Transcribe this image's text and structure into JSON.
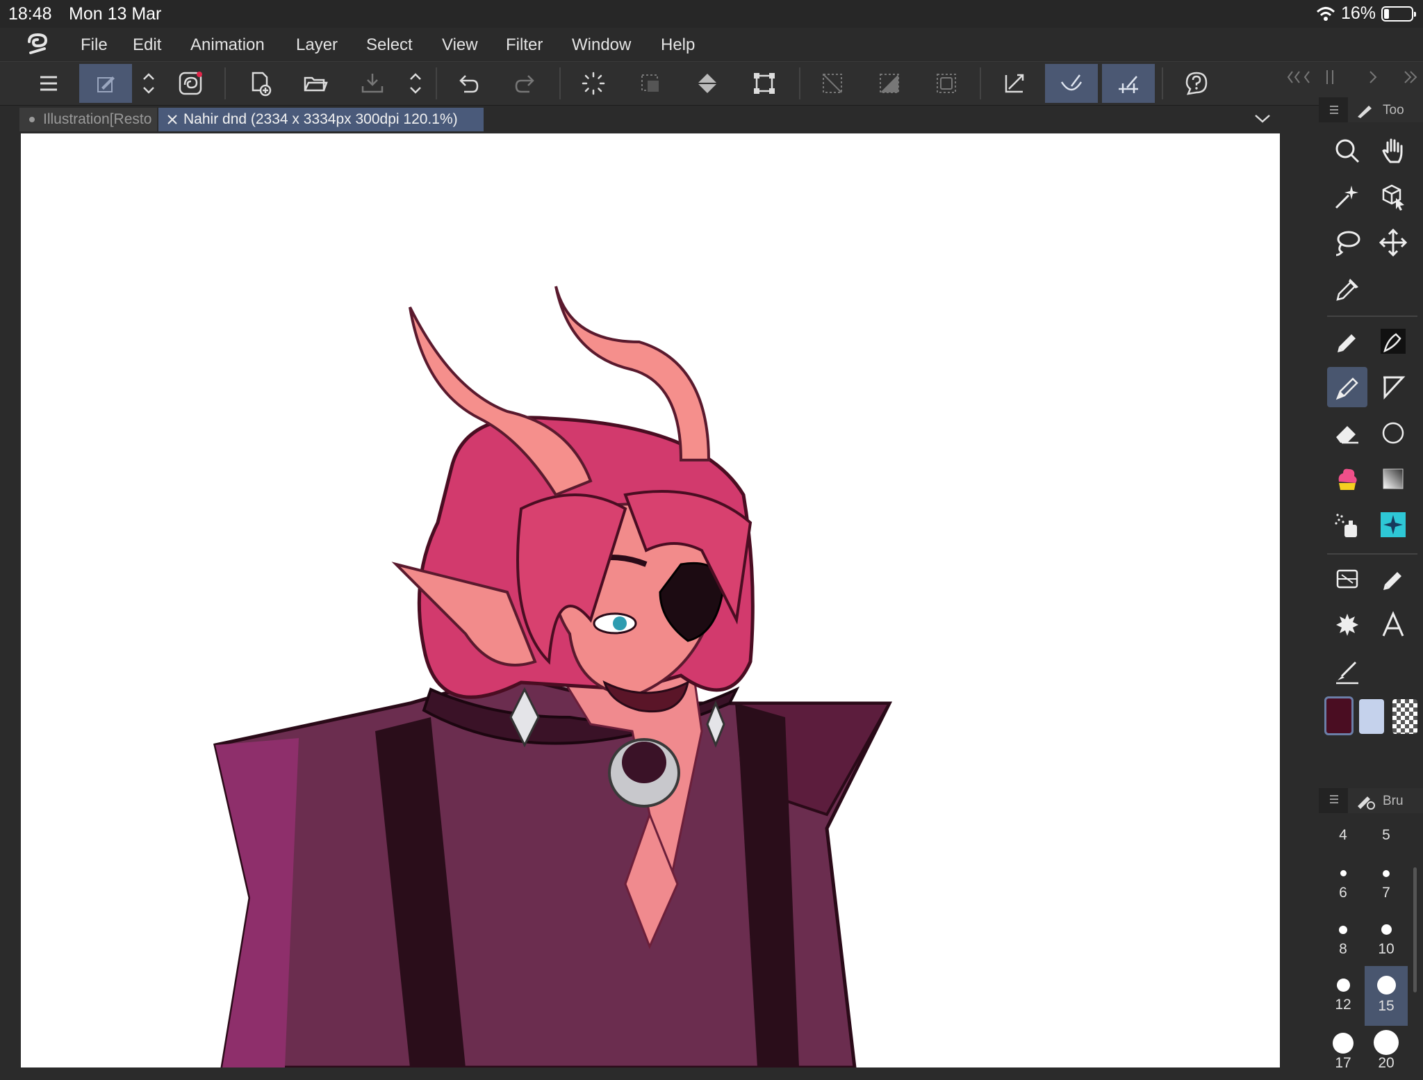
{
  "status": {
    "time": "18:48",
    "date": "Mon 13 Mar",
    "battery": "16%"
  },
  "menu": [
    "File",
    "Edit",
    "Animation",
    "Layer",
    "Select",
    "View",
    "Filter",
    "Window",
    "Help"
  ],
  "tabs": [
    {
      "label": "Illustration[Resto",
      "active": false
    },
    {
      "label": "Nahir dnd  (2334 x 3334px 300dpi 120.1%)",
      "active": true
    }
  ],
  "tool_panel": {
    "title": "Too"
  },
  "brush_panel": {
    "title": "Bru",
    "sizes": [
      "4",
      "5",
      "6",
      "7",
      "8",
      "10",
      "12",
      "15",
      "17",
      "20"
    ],
    "selected": "15"
  },
  "colors": {
    "main": "#4a0d22",
    "sub": "#c5d2ec",
    "accent": "#4b5873"
  }
}
